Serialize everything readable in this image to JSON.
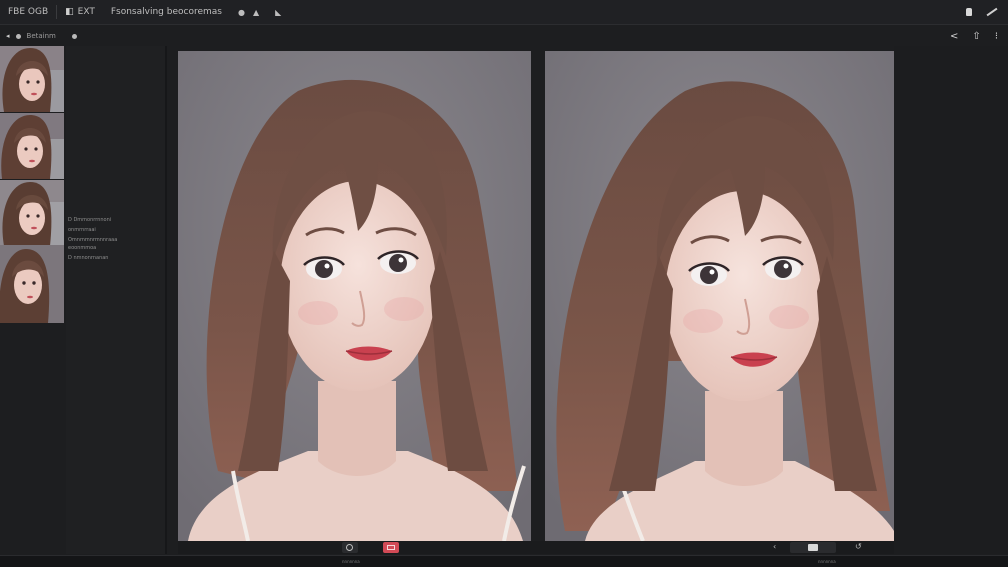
{
  "window": {
    "menu": {
      "brand": "FBE OGB",
      "edit": "EXT",
      "section": "Fsonsalving beocoremas"
    }
  },
  "toolbar": {
    "breadcrumb": "Betainm"
  },
  "sidepanel": {
    "lines": [
      "D  Dmmonrrnnoni",
      "onmrnrraai",
      "Omnmmnrmnnraaa",
      "eoonmmoa",
      "D  nmnonrnanan"
    ]
  },
  "bottom": {
    "left_status": "nnnnnna",
    "right_status": "nnnnnna"
  },
  "colors": {
    "accent_red": "#d24a56",
    "panel_bg": "#77757b",
    "app_bg": "#1d1e20"
  },
  "icons": [
    "camera-icon",
    "flag-icon",
    "lock-icon",
    "pen-icon",
    "share-icon",
    "upload-icon",
    "more-icon",
    "eye-icon",
    "chevron-icon",
    "book-icon",
    "back-icon"
  ]
}
